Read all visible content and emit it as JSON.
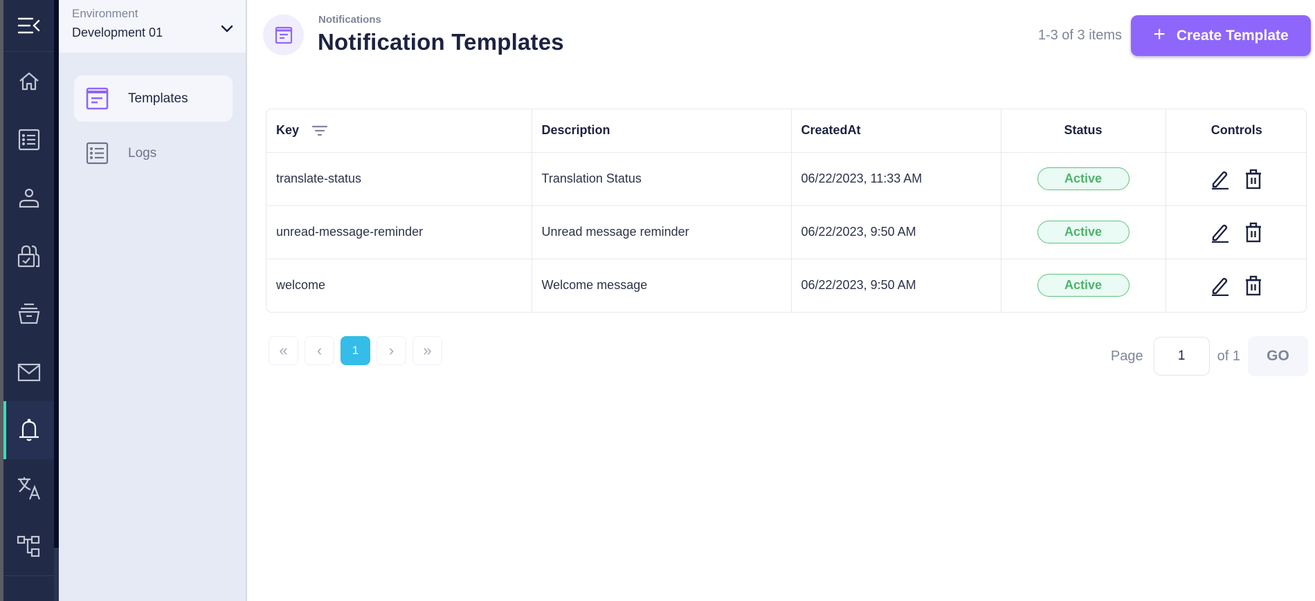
{
  "rail": {
    "items": [
      {
        "icon": "home-icon",
        "name": "home"
      },
      {
        "icon": "list-icon",
        "name": "list"
      },
      {
        "icon": "user-icon",
        "name": "users"
      },
      {
        "icon": "lock-check-icon",
        "name": "security"
      },
      {
        "icon": "archive-icon",
        "name": "archive"
      },
      {
        "icon": "mail-icon",
        "name": "mail"
      },
      {
        "icon": "bell-icon",
        "name": "notifications",
        "active": true
      },
      {
        "icon": "translate-icon",
        "name": "translations"
      },
      {
        "icon": "hierarchy-icon",
        "name": "hierarchy"
      }
    ],
    "tooltip": "Notifications",
    "accent_color": "#3ddbb0"
  },
  "environment": {
    "label": "Environment",
    "value": "Development 01"
  },
  "subnav": {
    "items": [
      {
        "label": "Templates",
        "icon": "template-icon",
        "active": true
      },
      {
        "label": "Logs",
        "icon": "list-icon",
        "active": false
      }
    ]
  },
  "header": {
    "breadcrumb": "Notifications",
    "title": "Notification Templates",
    "items_count": "1-3 of 3 items",
    "create_button": "Create Template",
    "brand_color": "#8f66fb"
  },
  "table": {
    "columns": {
      "key": "Key",
      "description": "Description",
      "created_at": "CreatedAt",
      "status": "Status",
      "controls": "Controls"
    },
    "rows": [
      {
        "key": "translate-status",
        "description": "Translation Status",
        "created_at": "06/22/2023, 11:33 AM",
        "status": "Active"
      },
      {
        "key": "unread-message-reminder",
        "description": "Unread message reminder",
        "created_at": "06/22/2023, 9:50 AM",
        "status": "Active"
      },
      {
        "key": "welcome",
        "description": "Welcome message",
        "created_at": "06/22/2023, 9:50 AM",
        "status": "Active"
      }
    ]
  },
  "pagination": {
    "first": "«",
    "prev": "‹",
    "current": "1",
    "next": "›",
    "last": "»",
    "page_label": "Page",
    "page_input_value": "1",
    "of_label": "of 1",
    "go_label": "GO",
    "current_color": "#33bde8"
  }
}
